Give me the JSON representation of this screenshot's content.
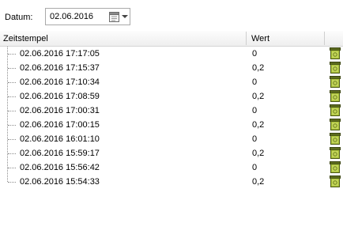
{
  "toolbar": {
    "date_label": "Datum:",
    "date_value": "02.06.2016",
    "calendar_icon": "calendar-icon",
    "dropdown_icon": "chevron-down-icon"
  },
  "table": {
    "columns": [
      "Zeitstempel",
      "Wert"
    ],
    "row_icon": "green-archive-icon",
    "rows": [
      {
        "timestamp": "02.06.2016 17:17:05",
        "value": "0"
      },
      {
        "timestamp": "02.06.2016 17:15:37",
        "value": "0,2"
      },
      {
        "timestamp": "02.06.2016 17:10:34",
        "value": "0"
      },
      {
        "timestamp": "02.06.2016 17:08:59",
        "value": "0,2"
      },
      {
        "timestamp": "02.06.2016 17:00:31",
        "value": "0"
      },
      {
        "timestamp": "02.06.2016 17:00:15",
        "value": "0,2"
      },
      {
        "timestamp": "02.06.2016 16:01:10",
        "value": "0"
      },
      {
        "timestamp": "02.06.2016 15:59:17",
        "value": "0,2"
      },
      {
        "timestamp": "02.06.2016 15:56:42",
        "value": "0"
      },
      {
        "timestamp": "02.06.2016 15:54:33",
        "value": "0,2"
      }
    ]
  }
}
